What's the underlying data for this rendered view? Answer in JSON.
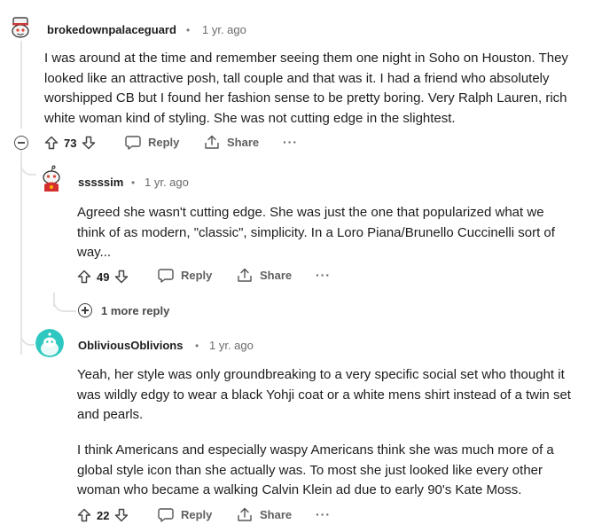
{
  "comments": [
    {
      "author": "brokedownpalaceguard",
      "separator": "•",
      "time": "1 yr. ago",
      "avatar": "snoo-avatar-hat-icon",
      "body": "I was around at the time and remember seeing them one night in Soho on Houston. They looked like an attractive posh, tall couple and that was it. I had a friend who absolutely worshipped CB but I found her fashion sense to be pretty boring. Very Ralph Lauren, rich white woman kind of styling. She was not cutting edge in the slightest.",
      "score": "73",
      "reply_label": "Reply",
      "share_label": "Share",
      "more_label": "···"
    },
    {
      "author": "sssssim",
      "separator": "•",
      "time": "1 yr. ago",
      "avatar": "snoo-avatar-red-icon",
      "body": "Agreed she wasn't cutting edge. She was just the one that popularized what we think of as modern, \"classic\", simplicity. In a Loro Piana/Brunello Cuccinelli sort of way...",
      "score": "49",
      "reply_label": "Reply",
      "share_label": "Share",
      "more_label": "···"
    },
    {
      "author": "ObliviousOblivions",
      "separator": "•",
      "time": "1 yr. ago",
      "avatar": "snoo-avatar-teal-icon",
      "body_p1": "Yeah, her style was only groundbreaking to a very specific social set who thought it was wildly edgy to wear a black Yohji coat or a white mens shirt instead of a twin set and pearls.",
      "body_p2": "I think Americans and especially waspy Americans think she was much more of a global style icon than she actually was. To most she just looked like every other woman who became a walking Calvin Klein ad due to early 90's Kate Moss.",
      "score": "22",
      "reply_label": "Reply",
      "share_label": "Share",
      "more_label": "···"
    }
  ],
  "more_replies_label": "1 more reply",
  "colors": {
    "text": "#1c1c1c",
    "meta": "#6a6a6a",
    "action": "#5f5f5f",
    "thread_line": "#e4e4e4",
    "teal_avatar": "#2fc8c0"
  }
}
